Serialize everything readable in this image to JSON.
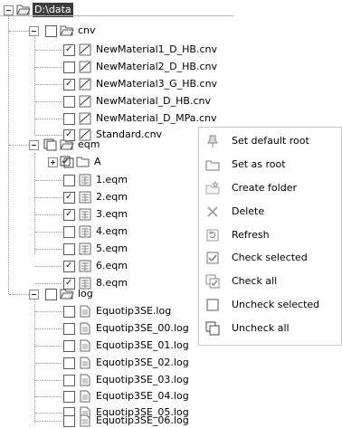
{
  "root": {
    "label": "D:\\data"
  },
  "folders": {
    "cnv": {
      "label": "cnv"
    },
    "eqm": {
      "label": "eqm"
    },
    "eqm_sub": {
      "label": "A"
    },
    "log": {
      "label": "log"
    }
  },
  "cnv_files": [
    {
      "label": "NewMaterial1_D_HB.cnv",
      "checked": true
    },
    {
      "label": "NewMaterial2_D_HB.cnv",
      "checked": false
    },
    {
      "label": "NewMaterial3_G_HB.cnv",
      "checked": true
    },
    {
      "label": "NewMaterial_D_HB.cnv",
      "checked": false
    },
    {
      "label": "NewMaterial_D_MPa.cnv",
      "checked": false
    },
    {
      "label": "Standard.cnv",
      "checked": true
    }
  ],
  "eqm_files": [
    {
      "label": "1.eqm",
      "checked": false
    },
    {
      "label": "2.eqm",
      "checked": true
    },
    {
      "label": "3.eqm",
      "checked": true
    },
    {
      "label": "4.eqm",
      "checked": false
    },
    {
      "label": "5.eqm",
      "checked": false
    },
    {
      "label": "6.eqm",
      "checked": true
    },
    {
      "label": "8.eqm",
      "checked": true
    }
  ],
  "log_files": [
    {
      "label": "Equotip3SE.log",
      "checked": false
    },
    {
      "label": "Equotip3SE_00.log",
      "checked": false
    },
    {
      "label": "Equotip3SE_01.log",
      "checked": false
    },
    {
      "label": "Equotip3SE_02.log",
      "checked": false
    },
    {
      "label": "Equotip3SE_03.log",
      "checked": false
    },
    {
      "label": "Equotip3SE_04.log",
      "checked": false
    },
    {
      "label": "Equotip3SE_05.log",
      "checked": false
    },
    {
      "label": "Equotip3SE_06.log",
      "checked": false
    }
  ],
  "context_menu": {
    "items": [
      {
        "label": "Set default root",
        "icon": "default-root-icon"
      },
      {
        "label": "Set as root",
        "icon": "folder-icon"
      },
      {
        "label": "Create folder",
        "icon": "new-folder-icon"
      },
      {
        "label": "Delete",
        "icon": "delete-icon"
      },
      {
        "label": "Refresh",
        "icon": "refresh-icon"
      },
      {
        "label": "Check selected",
        "icon": "check-selected-icon"
      },
      {
        "label": "Check all",
        "icon": "check-all-icon"
      },
      {
        "label": "Uncheck selected",
        "icon": "uncheck-selected-icon"
      },
      {
        "label": "Uncheck all",
        "icon": "uncheck-all-icon"
      }
    ]
  }
}
